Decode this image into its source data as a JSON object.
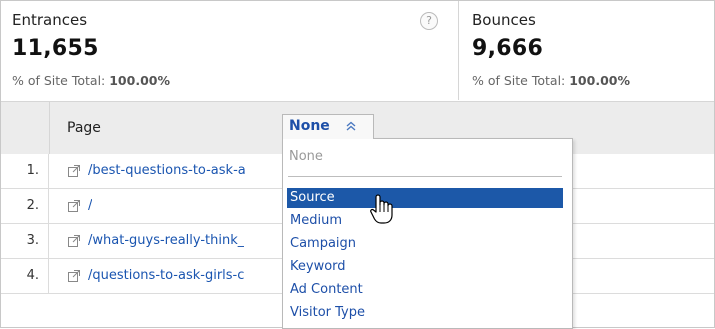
{
  "metrics": [
    {
      "title": "Entrances",
      "value": "11,655",
      "subtitle_prefix": "% of Site Total: ",
      "subtitle_value": "100.00%"
    },
    {
      "title": "Bounces",
      "value": "9,666",
      "subtitle_prefix": "% of Site Total: ",
      "subtitle_value": "100.00%"
    }
  ],
  "help_icon_text": "?",
  "table": {
    "primary_column": "Page",
    "rows": [
      {
        "index": "1.",
        "page": "/best-questions-to-ask-a"
      },
      {
        "index": "2.",
        "page": "/"
      },
      {
        "index": "3.",
        "page": "/what-guys-really-think_"
      },
      {
        "index": "4.",
        "page": "/questions-to-ask-girls-c"
      }
    ]
  },
  "secondary_dimension": {
    "selected_label": "None",
    "placeholder_option": "None",
    "options": [
      "Source",
      "Medium",
      "Campaign",
      "Keyword",
      "Ad Content",
      "Visitor Type"
    ],
    "highlighted_option": "Source"
  },
  "colors": {
    "link": "#1a55b0",
    "highlight": "#1c58a8",
    "header_bg": "#ececec"
  }
}
